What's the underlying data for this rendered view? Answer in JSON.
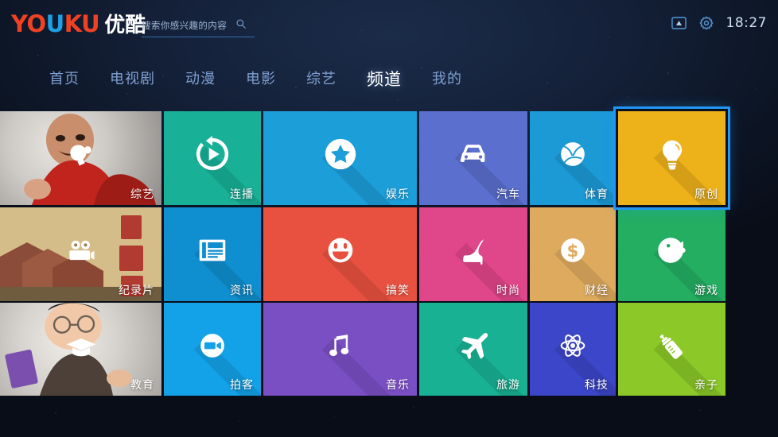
{
  "app": {
    "brand": {
      "part_red_1": "YO",
      "part_blue": "U",
      "part_red_2": "KU",
      "part_cn": "优酷"
    },
    "background_color": "#0d1626"
  },
  "search": {
    "placeholder": "搜索你感兴趣的内容",
    "value": "",
    "icon": "search-icon"
  },
  "status": {
    "cast_icon": "cast-screen-icon",
    "settings_icon": "gear-icon",
    "time": "18:27"
  },
  "nav": {
    "items": [
      {
        "label": "首页",
        "active": false
      },
      {
        "label": "电视剧",
        "active": false
      },
      {
        "label": "动漫",
        "active": false
      },
      {
        "label": "电影",
        "active": false
      },
      {
        "label": "综艺",
        "active": false
      },
      {
        "label": "频道",
        "active": true
      },
      {
        "label": "我的",
        "active": false
      }
    ]
  },
  "grid": {
    "selected_index": 5,
    "selection_color": "#2196f3",
    "tiles": [
      {
        "label": "综艺",
        "icon": "pingpong-paddle-icon",
        "type": "photo",
        "color": "#b8babc"
      },
      {
        "label": "连播",
        "icon": "play-circle-icon",
        "type": "color",
        "color": "#18b097"
      },
      {
        "label": "娱乐",
        "icon": "star-circle-icon",
        "type": "color",
        "color": "#1c9ed9"
      },
      {
        "label": "汽车",
        "icon": "car-icon",
        "type": "color",
        "color": "#5a6fce"
      },
      {
        "label": "体育",
        "icon": "ball-icon",
        "type": "color",
        "color": "#1b9ad6"
      },
      {
        "label": "原创",
        "icon": "lightbulb-icon",
        "type": "color",
        "color": "#edb11a"
      },
      {
        "label": "纪录片",
        "icon": "video-camera-icon",
        "type": "photo",
        "color": "#9a7a4e"
      },
      {
        "label": "资讯",
        "icon": "newspaper-icon",
        "type": "color",
        "color": "#0f8fd0"
      },
      {
        "label": "搞笑",
        "icon": "smiley-face-icon",
        "type": "color",
        "color": "#e8513f"
      },
      {
        "label": "时尚",
        "icon": "high-heel-shoe-icon",
        "type": "color",
        "color": "#e0468a"
      },
      {
        "label": "财经",
        "icon": "dollar-coin-icon",
        "type": "color",
        "color": "#deab5e"
      },
      {
        "label": "游戏",
        "icon": "pacman-icon",
        "type": "color",
        "color": "#23ae62"
      },
      {
        "label": "教育",
        "icon": "graduation-cap-icon",
        "type": "photo",
        "color": "#c9c6c2"
      },
      {
        "label": "拍客",
        "icon": "camcorder-circle-icon",
        "type": "color",
        "color": "#13a2e8"
      },
      {
        "label": "音乐",
        "icon": "music-note-icon",
        "type": "color",
        "color": "#7b4fc4"
      },
      {
        "label": "旅游",
        "icon": "airplane-icon",
        "type": "color",
        "color": "#18b193"
      },
      {
        "label": "科技",
        "icon": "atom-icon",
        "type": "color",
        "color": "#3b46c8"
      },
      {
        "label": "亲子",
        "icon": "baby-bottle-icon",
        "type": "color",
        "color": "#8bc828"
      }
    ]
  }
}
